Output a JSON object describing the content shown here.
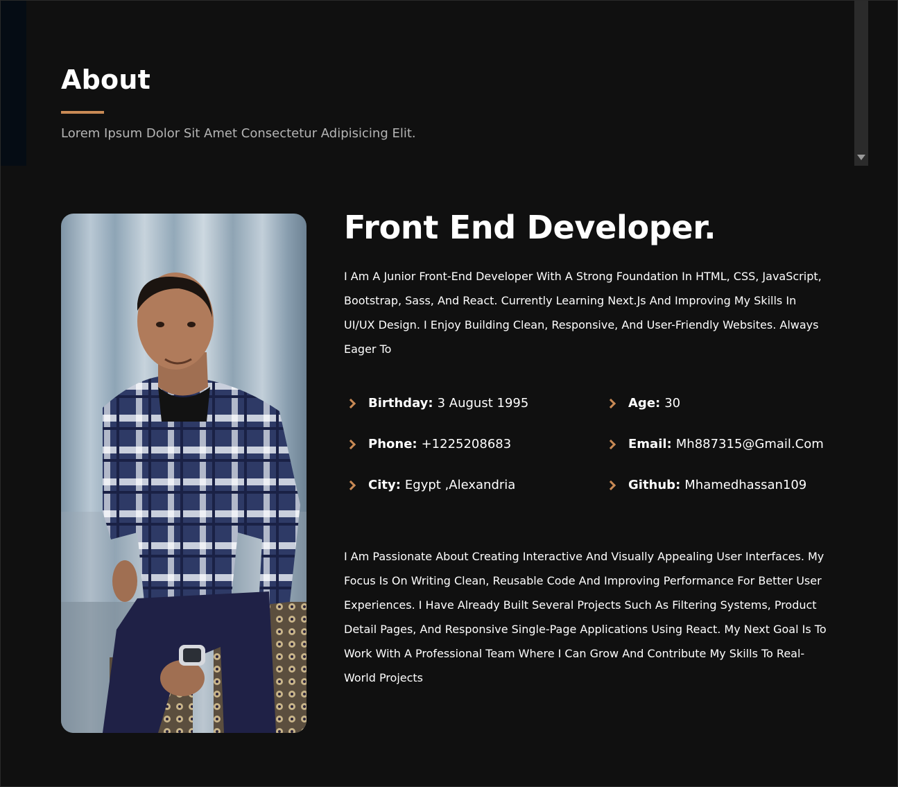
{
  "section": {
    "title": "About",
    "subtitle": "Lorem Ipsum Dolor Sit Amet Consectetur Adipisicing Elit."
  },
  "colors": {
    "accent": "#c98a55",
    "background": "#101010",
    "text": "#ffffff",
    "muted": "#b5b5b5"
  },
  "profile": {
    "photo": "profile-photo",
    "headline": "Front End Developer.",
    "intro": "I Am A Junior Front-End Developer With A Strong Foundation In HTML, CSS, JavaScript, Bootstrap, Sass, And React. Currently Learning Next.Js And Improving My Skills In UI/UX Design. I Enjoy Building Clean, Responsive, And User-Friendly Websites. Always Eager To",
    "details": {
      "birthday": {
        "label": "Birthday:",
        "value": "3 August 1995"
      },
      "age": {
        "label": "Age:",
        "value": "30"
      },
      "phone": {
        "label": "Phone:",
        "value": "+1225208683"
      },
      "email": {
        "label": "Email:",
        "value": "Mh887315@Gmail.Com"
      },
      "city": {
        "label": "City:",
        "value": "Egypt ,Alexandria"
      },
      "github": {
        "label": "Github:",
        "value": "Mhamedhassan109"
      }
    },
    "bio": "I Am Passionate About Creating Interactive And Visually Appealing User Interfaces. My Focus Is On Writing Clean, Reusable Code And Improving Performance For Better User Experiences. I Have Already Built Several Projects Such As Filtering Systems, Product Detail Pages, And Responsive Single-Page Applications Using React. My Next Goal Is To Work With A Professional Team Where I Can Grow And Contribute My Skills To Real-World Projects"
  },
  "icons": {
    "detail_bullet": "chevron-right-icon",
    "scroll_down": "caret-down-icon"
  }
}
